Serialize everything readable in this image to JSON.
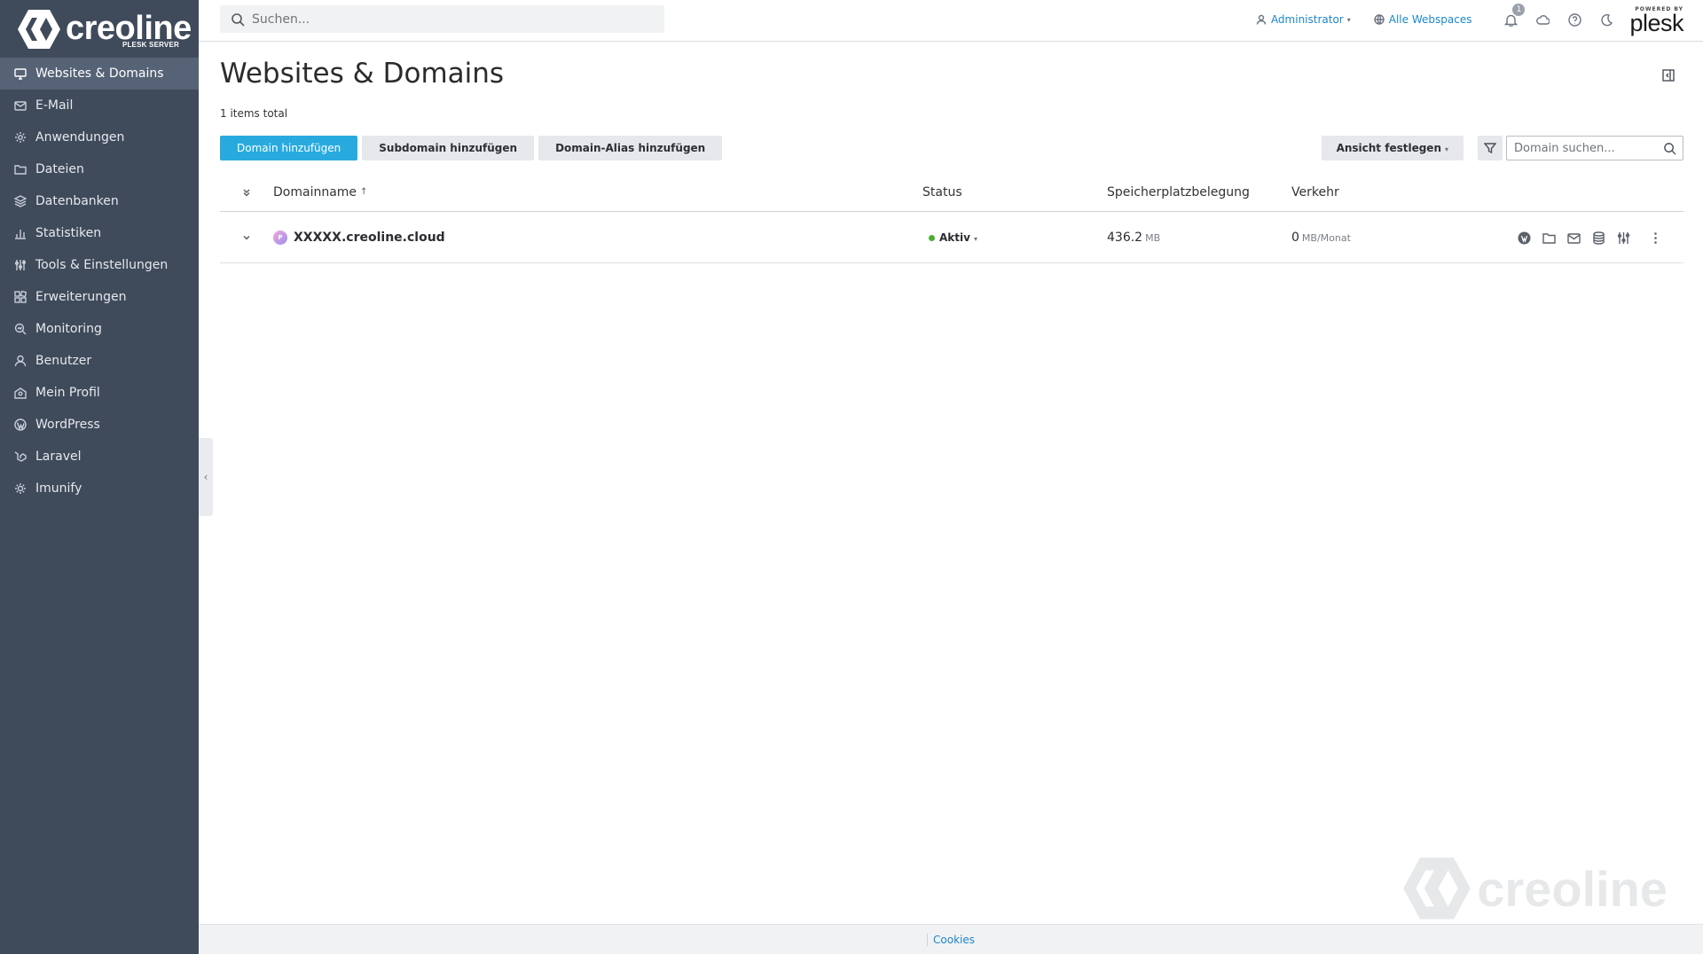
{
  "brand": {
    "name": "creoline",
    "subtitle": "PLESK SERVER",
    "logo_icon": "creoline-hexagon-logo"
  },
  "sidebar": {
    "items": [
      {
        "label": "Websites & Domains",
        "icon": "monitor-icon",
        "active": true
      },
      {
        "label": "E-Mail",
        "icon": "envelope-icon",
        "active": false
      },
      {
        "label": "Anwendungen",
        "icon": "gear-icon",
        "active": false
      },
      {
        "label": "Dateien",
        "icon": "folder-icon",
        "active": false
      },
      {
        "label": "Datenbanken",
        "icon": "stack-icon",
        "active": false
      },
      {
        "label": "Statistiken",
        "icon": "bar-chart-icon",
        "active": false
      },
      {
        "label": "Tools & Einstellungen",
        "icon": "sliders-icon",
        "active": false
      },
      {
        "label": "Erweiterungen",
        "icon": "puzzle-icon",
        "active": false
      },
      {
        "label": "Monitoring",
        "icon": "magnifier-chart-icon",
        "active": false
      },
      {
        "label": "Benutzer",
        "icon": "user-icon",
        "active": false
      },
      {
        "label": "Mein Profil",
        "icon": "profile-card-icon",
        "active": false
      },
      {
        "label": "WordPress",
        "icon": "wordpress-icon",
        "active": false
      },
      {
        "label": "Laravel",
        "icon": "laravel-icon",
        "active": false
      },
      {
        "label": "Imunify",
        "icon": "shield-gear-icon",
        "active": false
      }
    ],
    "collapse_glyph": "‹"
  },
  "topbar": {
    "search_placeholder": "Suchen...",
    "user_label": "Administrator",
    "webspaces_label": "Alle Webspaces",
    "notification_count": "1",
    "powered_by": "POWERED BY",
    "plesk_logo": "plesk"
  },
  "main": {
    "title": "Websites & Domains",
    "items_total": "1 items total",
    "buttons": {
      "add_domain": "Domain hinzufügen",
      "add_subdomain": "Subdomain hinzufügen",
      "add_alias": "Domain-Alias hinzufügen",
      "view_settings": "Ansicht festlegen"
    },
    "domain_search_placeholder": "Domain suchen..."
  },
  "table": {
    "columns": {
      "name": "Domainname",
      "status": "Status",
      "storage": "Speicherplatzbelegung",
      "traffic": "Verkehr"
    },
    "sort_indicator": "↑",
    "rows": [
      {
        "domain": "XXXXX.creoline.cloud",
        "status": "Aktiv",
        "status_color": "#4caf33",
        "storage_value": "436.2",
        "storage_unit": "MB",
        "traffic_value": "0",
        "traffic_unit": "MB/Monat"
      }
    ]
  },
  "footer": {
    "cookies": "Cookies"
  },
  "colors": {
    "sidebar_bg": "#3f4a5b",
    "sidebar_active": "#566275",
    "primary": "#28aade",
    "link": "#1d87c8"
  },
  "watermark": "creoline"
}
